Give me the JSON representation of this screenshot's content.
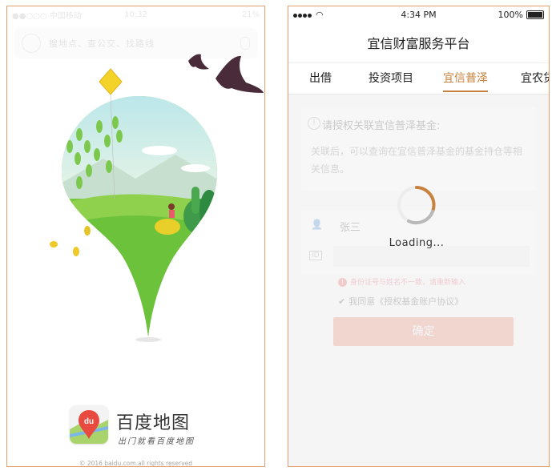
{
  "left_phone": {
    "status": {
      "carrier": "●●○○○ 中国移动",
      "time": "10:32",
      "battery": "21%"
    },
    "search": {
      "hint": "搜地点、查公交、找路线"
    },
    "brand": {
      "logo_text": "du",
      "name": "百度地图",
      "slogan": "出门就看百度地图"
    },
    "copyright": "© 2016 baidu.com.all rights reserved"
  },
  "right_phone": {
    "status": {
      "time": "4:34 PM",
      "battery": "100%"
    },
    "nav_title": "宜信财富服务平台",
    "tabs": [
      "出借",
      "投资项目",
      "宜信普泽",
      "宜农贷"
    ],
    "active_tab": "宜信普泽",
    "auth_card": {
      "title": "请授权关联宜信普泽基金:",
      "desc": "关联后，可以查询在宜信普泽基金的基金持仓等相关信息。"
    },
    "form": {
      "name": "张三",
      "id_label": "ID"
    },
    "error_text": "身份证号与姓名不一致，请重新输入",
    "agree_text": "我同意《授权基金账户协议》",
    "confirm_label": "确定",
    "loading_text": "Loading..."
  },
  "colors": {
    "accent": "#c8823e",
    "frame": "#e2a070",
    "danger": "#e03a3a",
    "button": "#e36b4a"
  }
}
